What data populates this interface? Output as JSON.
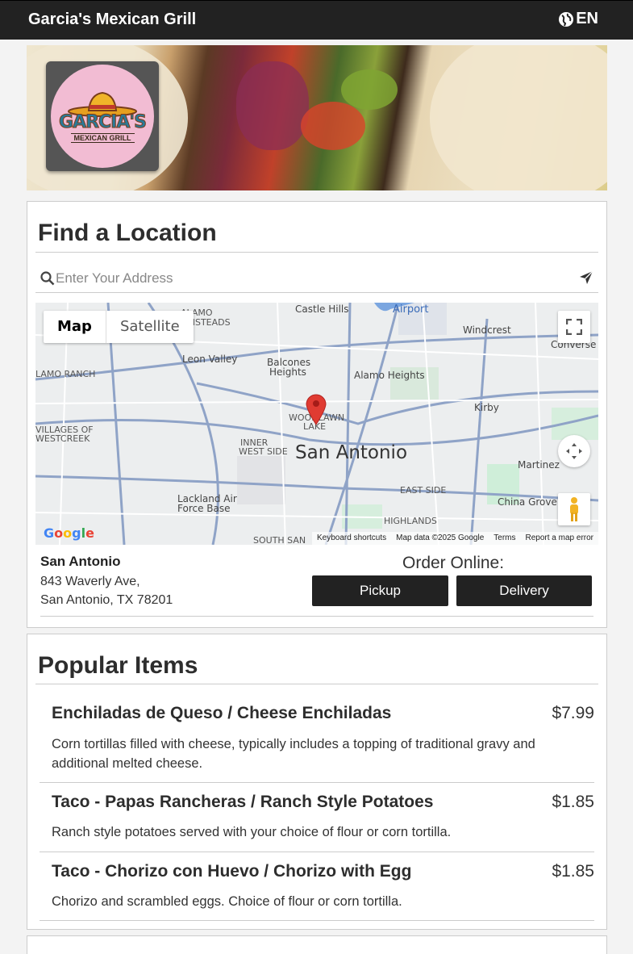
{
  "header": {
    "brand": "Garcia's Mexican Grill",
    "language": "EN"
  },
  "logo": {
    "title": "GARCIA'S",
    "subtitle": "MEXICAN GRILL"
  },
  "locations": {
    "title": "Find a Location",
    "search_placeholder": "Enter Your Address",
    "map": {
      "toggle_map": "Map",
      "toggle_satellite": "Satellite",
      "city_label": "San Antonio",
      "labels": [
        "Castle Hills",
        "Airport",
        "Windcrest",
        "Converse",
        "Leon Valley",
        "Balcones Heights",
        "Alamo Heights",
        "Kirby",
        "Woodlawn Lake",
        "Inner West Side",
        "Martinez",
        "Lackland Air Force Base",
        "East Side",
        "China Grove",
        "Highlands",
        "South San",
        "Villages of Westcreek",
        "Lamo Ranch",
        "Alamo Farmsteads"
      ],
      "footer": [
        "Keyboard shortcuts",
        "Map data ©2025 Google",
        "Terms",
        "Report a map error"
      ],
      "google": "Google"
    },
    "location_name": "San Antonio",
    "address_line1": "843 Waverly Ave,",
    "address_line2": "San Antonio, TX 78201",
    "order_label": "Order Online:",
    "pickup": "Pickup",
    "delivery": "Delivery"
  },
  "popular": {
    "title": "Popular Items",
    "items": [
      {
        "name": "Enchiladas de Queso / Cheese Enchiladas",
        "price": "$7.99",
        "desc": "Corn tortillas filled with cheese, typically includes a topping of traditional gravy and additional melted cheese."
      },
      {
        "name": "Taco - Papas Rancheras / Ranch Style Potatoes",
        "price": "$1.85",
        "desc": "Ranch style potatoes served with your choice of flour or corn tortilla."
      },
      {
        "name": "Taco - Chorizo con Huevo / Chorizo with Egg",
        "price": "$1.85",
        "desc": "Chorizo and scrambled eggs. Choice of flour or corn tortilla."
      }
    ]
  },
  "colors": {
    "header_bg": "#222222",
    "button_bg": "#222222",
    "pin": "#e03b32",
    "logo_bg": "#f2bcd3"
  }
}
